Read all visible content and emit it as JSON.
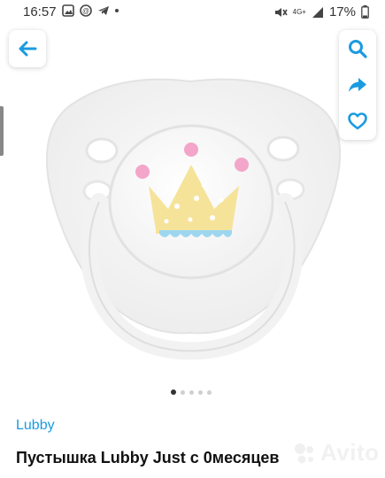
{
  "status_bar": {
    "time": "16:57",
    "network": "4G+",
    "battery": "17%"
  },
  "product": {
    "brand": "Lubby",
    "title": "Пустышка Lubby Just с 0месяцев",
    "image_count": 5,
    "active_image_index": 0
  },
  "icons": {
    "back": "arrow-left-icon",
    "search": "search-icon",
    "share": "share-icon",
    "favorite": "heart-icon"
  },
  "colors": {
    "accent": "#1a9be0",
    "crown": "#f6e39a",
    "crown_dots": "#f3a6c9",
    "crown_base": "#9ed6f0"
  },
  "watermark": {
    "text": "Avito"
  }
}
